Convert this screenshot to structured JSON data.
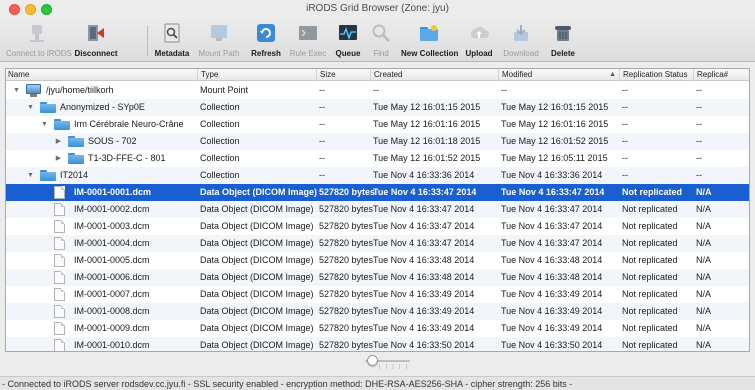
{
  "window": {
    "title": "iRODS Grid Browser (Zone: jyu)"
  },
  "toolbar": {
    "buttons": [
      {
        "label": "Connect to iRODS",
        "icon": "connect-icon",
        "enabled": false
      },
      {
        "label": "Disconnect",
        "icon": "disconnect-icon",
        "enabled": true
      },
      {
        "label": "Metadata",
        "icon": "metadata-icon",
        "enabled": true
      },
      {
        "label": "Mount Path",
        "icon": "mount-path-icon",
        "enabled": false
      },
      {
        "label": "Refresh",
        "icon": "refresh-icon",
        "enabled": true
      },
      {
        "label": "Rule Exec",
        "icon": "terminal-icon",
        "enabled": false
      },
      {
        "label": "Queue",
        "icon": "queue-icon",
        "enabled": true
      },
      {
        "label": "Find",
        "icon": "find-icon",
        "enabled": false
      },
      {
        "label": "New Collection",
        "icon": "new-folder-icon",
        "enabled": true
      },
      {
        "label": "Upload",
        "icon": "upload-icon",
        "enabled": true
      },
      {
        "label": "Download",
        "icon": "download-icon",
        "enabled": false
      },
      {
        "label": "Delete",
        "icon": "delete-icon",
        "enabled": true
      }
    ]
  },
  "table": {
    "columns": {
      "name": "Name",
      "type": "Type",
      "size": "Size",
      "created": "Created",
      "modified": "Modified",
      "replication": "Replication Status",
      "replica": "Replica#"
    },
    "sort_indicator": "▲",
    "rows": [
      {
        "name": "/jyu/home/tiilkorh",
        "type": "Mount Point",
        "size": "--",
        "created": "--",
        "modified": "--",
        "replication": "--",
        "replica": "--",
        "kind": "mount",
        "level": 0,
        "expanded": true
      },
      {
        "name": "Anonymized - SYp0E",
        "type": "Collection",
        "size": "--",
        "created": "Tue May 12 16:01:15 2015",
        "modified": "Tue May 12 16:01:15 2015",
        "replication": "--",
        "replica": "--",
        "kind": "folder",
        "level": 1,
        "expanded": true
      },
      {
        "name": "Irm Cérébrale Neuro-Crâne",
        "type": "Collection",
        "size": "--",
        "created": "Tue May 12 16:01:16 2015",
        "modified": "Tue May 12 16:01:16 2015",
        "replication": "--",
        "replica": "--",
        "kind": "folder",
        "level": 2,
        "expanded": true
      },
      {
        "name": "SOUS - 702",
        "type": "Collection",
        "size": "--",
        "created": "Tue May 12 16:01:18 2015",
        "modified": "Tue May 12 16:01:52 2015",
        "replication": "--",
        "replica": "--",
        "kind": "folder",
        "level": 3,
        "expanded": false
      },
      {
        "name": "T1-3D-FFE-C - 801",
        "type": "Collection",
        "size": "--",
        "created": "Tue May 12 16:01:52 2015",
        "modified": "Tue May 12 16:05:11 2015",
        "replication": "--",
        "replica": "--",
        "kind": "folder",
        "level": 3,
        "expanded": false
      },
      {
        "name": "IT2014",
        "type": "Collection",
        "size": "--",
        "created": "Tue Nov  4 16:33:36 2014",
        "modified": "Tue Nov  4 16:33:36 2014",
        "replication": "--",
        "replica": "--",
        "kind": "folder",
        "level": 1,
        "expanded": true
      },
      {
        "name": "IM-0001-0001.dcm",
        "type": "Data Object (DICOM Image)",
        "size": "527820 bytes",
        "created": "Tue Nov  4 16:33:47 2014",
        "modified": "Tue Nov  4 16:33:47 2014",
        "replication": "Not replicated",
        "replica": "N/A",
        "kind": "file",
        "level": 2,
        "selected": true
      },
      {
        "name": "IM-0001-0002.dcm",
        "type": "Data Object (DICOM Image)",
        "size": "527820 bytes",
        "created": "Tue Nov  4 16:33:47 2014",
        "modified": "Tue Nov  4 16:33:47 2014",
        "replication": "Not replicated",
        "replica": "N/A",
        "kind": "file",
        "level": 2
      },
      {
        "name": "IM-0001-0003.dcm",
        "type": "Data Object (DICOM Image)",
        "size": "527820 bytes",
        "created": "Tue Nov  4 16:33:47 2014",
        "modified": "Tue Nov  4 16:33:47 2014",
        "replication": "Not replicated",
        "replica": "N/A",
        "kind": "file",
        "level": 2
      },
      {
        "name": "IM-0001-0004.dcm",
        "type": "Data Object (DICOM Image)",
        "size": "527820 bytes",
        "created": "Tue Nov  4 16:33:47 2014",
        "modified": "Tue Nov  4 16:33:47 2014",
        "replication": "Not replicated",
        "replica": "N/A",
        "kind": "file",
        "level": 2
      },
      {
        "name": "IM-0001-0005.dcm",
        "type": "Data Object (DICOM Image)",
        "size": "527820 bytes",
        "created": "Tue Nov  4 16:33:48 2014",
        "modified": "Tue Nov  4 16:33:48 2014",
        "replication": "Not replicated",
        "replica": "N/A",
        "kind": "file",
        "level": 2
      },
      {
        "name": "IM-0001-0006.dcm",
        "type": "Data Object (DICOM Image)",
        "size": "527820 bytes",
        "created": "Tue Nov  4 16:33:48 2014",
        "modified": "Tue Nov  4 16:33:48 2014",
        "replication": "Not replicated",
        "replica": "N/A",
        "kind": "file",
        "level": 2
      },
      {
        "name": "IM-0001-0007.dcm",
        "type": "Data Object (DICOM Image)",
        "size": "527820 bytes",
        "created": "Tue Nov  4 16:33:49 2014",
        "modified": "Tue Nov  4 16:33:49 2014",
        "replication": "Not replicated",
        "replica": "N/A",
        "kind": "file",
        "level": 2
      },
      {
        "name": "IM-0001-0008.dcm",
        "type": "Data Object (DICOM Image)",
        "size": "527820 bytes",
        "created": "Tue Nov  4 16:33:49 2014",
        "modified": "Tue Nov  4 16:33:49 2014",
        "replication": "Not replicated",
        "replica": "N/A",
        "kind": "file",
        "level": 2
      },
      {
        "name": "IM-0001-0009.dcm",
        "type": "Data Object (DICOM Image)",
        "size": "527820 bytes",
        "created": "Tue Nov  4 16:33:49 2014",
        "modified": "Tue Nov  4 16:33:49 2014",
        "replication": "Not replicated",
        "replica": "N/A",
        "kind": "file",
        "level": 2
      },
      {
        "name": "IM-0001-0010.dcm",
        "type": "Data Object (DICOM Image)",
        "size": "527820 bytes",
        "created": "Tue Nov  4 16:33:50 2014",
        "modified": "Tue Nov  4 16:33:50 2014",
        "replication": "Not replicated",
        "replica": "N/A",
        "kind": "file",
        "level": 2
      }
    ]
  },
  "statusbar": {
    "text": "- Connected to iRODS server rodsdev.cc.jyu.fi - SSL security enabled - encryption method: DHE-RSA-AES256-SHA - cipher strength: 256 bits -"
  },
  "colors": {
    "selection": "#1a5fd1",
    "folder": "#3b91d7",
    "alt_row": "#f2f5fa"
  }
}
